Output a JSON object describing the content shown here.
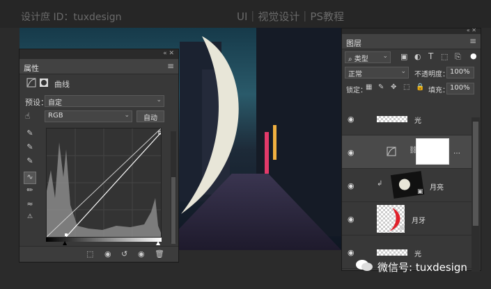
{
  "banner": {
    "left": "设计庶 ID：tuxdesign",
    "center": "UI｜视觉设计｜PS教程"
  },
  "properties": {
    "tab": "属性",
    "mode_label": "曲线",
    "preset_label": "预设：",
    "preset_value": "自定",
    "channel_value": "RGB",
    "auto_button": "自动"
  },
  "layers": {
    "tab": "图层",
    "filter_value": "类型",
    "blend_mode": "正常",
    "opacity_label": "不透明度：",
    "opacity_value": "100%",
    "lock_label": "锁定：",
    "fill_label": "填充：",
    "fill_value": "100%",
    "items": [
      {
        "name": "光"
      },
      {
        "name": ""
      },
      {
        "name": "月亮"
      },
      {
        "name": "月牙"
      },
      {
        "name": "光"
      }
    ]
  },
  "watermark": {
    "text": "微信号: tuxdesign"
  }
}
